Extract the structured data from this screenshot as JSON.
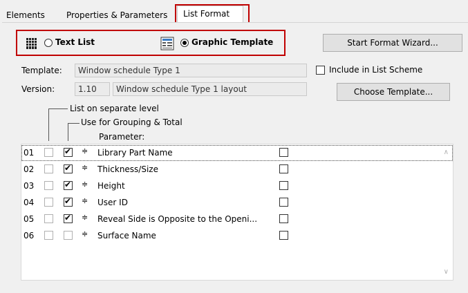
{
  "tabs": [
    {
      "label": "Elements"
    },
    {
      "label": "Properties & Parameters"
    },
    {
      "label": "List Format",
      "active": true
    }
  ],
  "format": {
    "text_list_label": "Text List",
    "graphic_template_label": "Graphic Template",
    "selected": "Graphic Template",
    "wizard_button": "Start Format Wizard..."
  },
  "template": {
    "template_label": "Template:",
    "template_value": "Window schedule Type 1",
    "version_label": "Version:",
    "version_value": "1.10",
    "version_desc": "Window schedule Type 1 layout",
    "include_label": "Include in List Scheme",
    "include_checked": false,
    "choose_button": "Choose Template..."
  },
  "legend": {
    "separate_level": "List on separate level",
    "grouping_total": "Use for Grouping & Total",
    "parameter": "Parameter:"
  },
  "rows": [
    {
      "num": "01",
      "separate": false,
      "grouping": true,
      "name": "Library Part Name",
      "last": false
    },
    {
      "num": "02",
      "separate": false,
      "grouping": true,
      "name": "Thickness/Size",
      "last": false
    },
    {
      "num": "03",
      "separate": false,
      "grouping": true,
      "name": "Height",
      "last": false
    },
    {
      "num": "04",
      "separate": false,
      "grouping": true,
      "name": "User ID",
      "last": false
    },
    {
      "num": "05",
      "separate": false,
      "grouping": true,
      "name": "Reveal Side is Opposite to the Openi...",
      "last": false
    },
    {
      "num": "06",
      "separate": false,
      "grouping": false,
      "name": "Surface Name",
      "last": false
    }
  ],
  "sort_glyph": "≑",
  "colors": {
    "highlight_border": "#c00000"
  }
}
